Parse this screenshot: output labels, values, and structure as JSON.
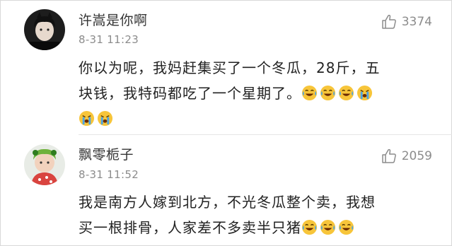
{
  "comments": [
    {
      "username": "许嵩是你啊",
      "time": "8-31 11:23",
      "likes": "3374",
      "avatar_icon": "avatar-dark-photo",
      "text_lines": [
        "你以为呢，我妈赶集买了一个冬瓜，28斤，五",
        "块钱，我特码都吃了一个星期了。"
      ],
      "emoji_line1_after": [
        "laugh-cry-emoji",
        "laugh-cry-emoji",
        "laugh-cry-emoji",
        "crying-emoji"
      ],
      "emoji_line2": [
        "crying-emoji",
        "crying-emoji"
      ]
    },
    {
      "username": "飘零栀子",
      "time": "8-31 11:52",
      "likes": "2059",
      "avatar_icon": "avatar-baby-photo",
      "text_lines": [
        "我是南方人嫁到北方，不光冬瓜整个卖，我想",
        "买一根排骨，人家差不多卖半只猪"
      ],
      "emoji_line2_after": [
        "laugh-cry-emoji",
        "laugh-cry-emoji",
        "laugh-cry-emoji"
      ]
    }
  ],
  "colors": {
    "username": "#333333",
    "meta": "#8c8c8c",
    "text": "#222222",
    "emoji_face": "#f7c53a",
    "emoji_tear": "#4aa3e8"
  }
}
